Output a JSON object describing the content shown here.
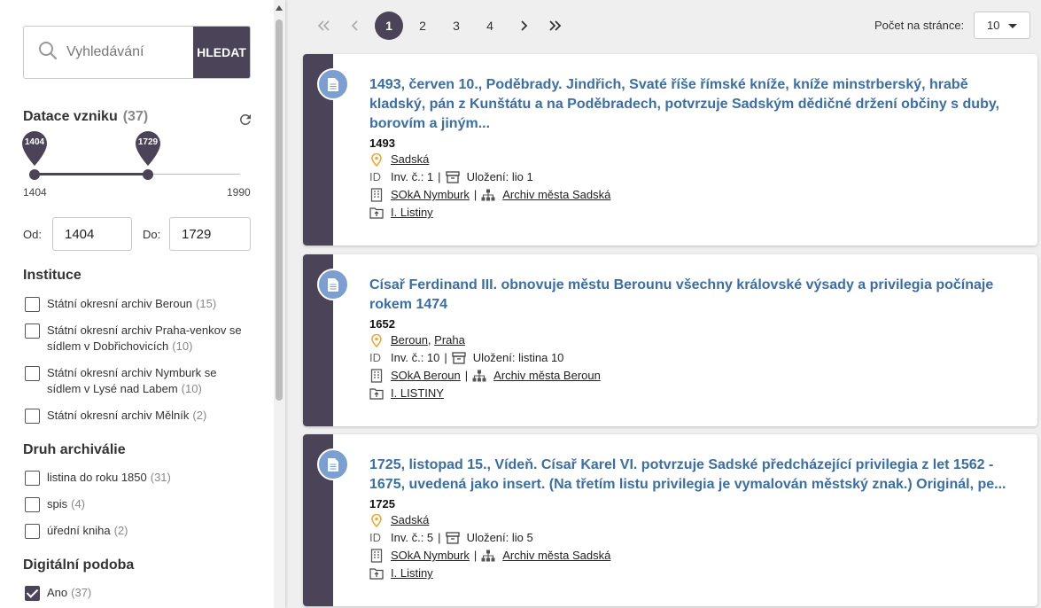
{
  "search": {
    "placeholder": "Vyhledávání",
    "button": "HLEDAT"
  },
  "date_filter": {
    "title": "Datace vzniku",
    "count": "(37)",
    "handle_from": "1404",
    "handle_to": "1729",
    "min_label": "1404",
    "max_label": "1990",
    "from_label": "Od:",
    "to_label": "Do:",
    "from_value": "1404",
    "to_value": "1729"
  },
  "institutions": {
    "title": "Instituce",
    "items": [
      {
        "label": "Státní okresní archiv Beroun",
        "count": "(15)",
        "checked": false
      },
      {
        "label_line1": "Státní okresní archiv Praha-venkov se",
        "label_line2": "sídlem v Dobřichovicích",
        "count": "(10)",
        "checked": false
      },
      {
        "label_line1": "Státní okresní archiv Nymburk se",
        "label_line2": "sídlem v Lysé nad Labem",
        "count": "(10)",
        "checked": false
      },
      {
        "label": "Státní okresní archiv Mělník",
        "count": "(2)",
        "checked": false
      }
    ]
  },
  "archive_types": {
    "title": "Druh archiválie",
    "items": [
      {
        "label": "listina do roku 1850",
        "count": "(31)",
        "checked": false
      },
      {
        "label": "spis",
        "count": "(4)",
        "checked": false
      },
      {
        "label": "úřední kniha",
        "count": "(2)",
        "checked": false
      }
    ]
  },
  "digital": {
    "title": "Digitální podoba",
    "items": [
      {
        "label": "Ano",
        "count": "(37)",
        "checked": true
      }
    ]
  },
  "pagination": {
    "first": "«",
    "prev": "‹",
    "pages": [
      "1",
      "2",
      "3",
      "4"
    ],
    "active_page": "1",
    "next": "›",
    "last": "»",
    "per_page_label": "Počet na stránce:",
    "per_page_value": "10"
  },
  "results": [
    {
      "title": "1493, červen 10., Poděbrady. Jindřich, Svaté říše římské kníže, kníže minstrberský, hrabě kladský, pán z Kunštátu a na Poděbradech, potvrzuje Sadským dědičné držení občiny s duby, borovím a jiným...",
      "year": "1493",
      "places": [
        "Sadská"
      ],
      "id_tag": "ID",
      "inv": "Inv. č.: 1",
      "storage": "Uložení: lio 1",
      "institution": "SOkA Nymburk",
      "fond": "Archiv města Sadská",
      "series": "I. Listiny"
    },
    {
      "title": "Císař Ferdinand III. obnovuje městu Berounu všechny královské výsady a privilegia počínaje rokem 1474",
      "year": "1652",
      "places": [
        "Beroun",
        "Praha"
      ],
      "id_tag": "ID",
      "inv": "Inv. č.: 10",
      "storage": "Uložení: listina 10",
      "institution": "SOkA Beroun",
      "fond": "Archiv města Beroun",
      "series": "I. LISTINY"
    },
    {
      "title": "1725, listopad 15., Vídeň. Císař Karel VI. potvrzuje Sadské předcházející privilegia z let 1562 - 1675, uvedená jako insert. (Na třetím listu privilegia je vymalován městský znak.) Originál, pe...",
      "year": "1725",
      "places": [
        "Sadská"
      ],
      "id_tag": "ID",
      "inv": "Inv. č.: 5",
      "storage": "Uložení: lio 5",
      "institution": "SOkA Nymburk",
      "fond": "Archiv města Sadská",
      "series": "I. Listiny"
    }
  ],
  "colors": {
    "accent": "#4b4458",
    "link": "#3a6ea5",
    "doc_icon": "#7b9fd0",
    "place_icon": "#f0a830"
  }
}
